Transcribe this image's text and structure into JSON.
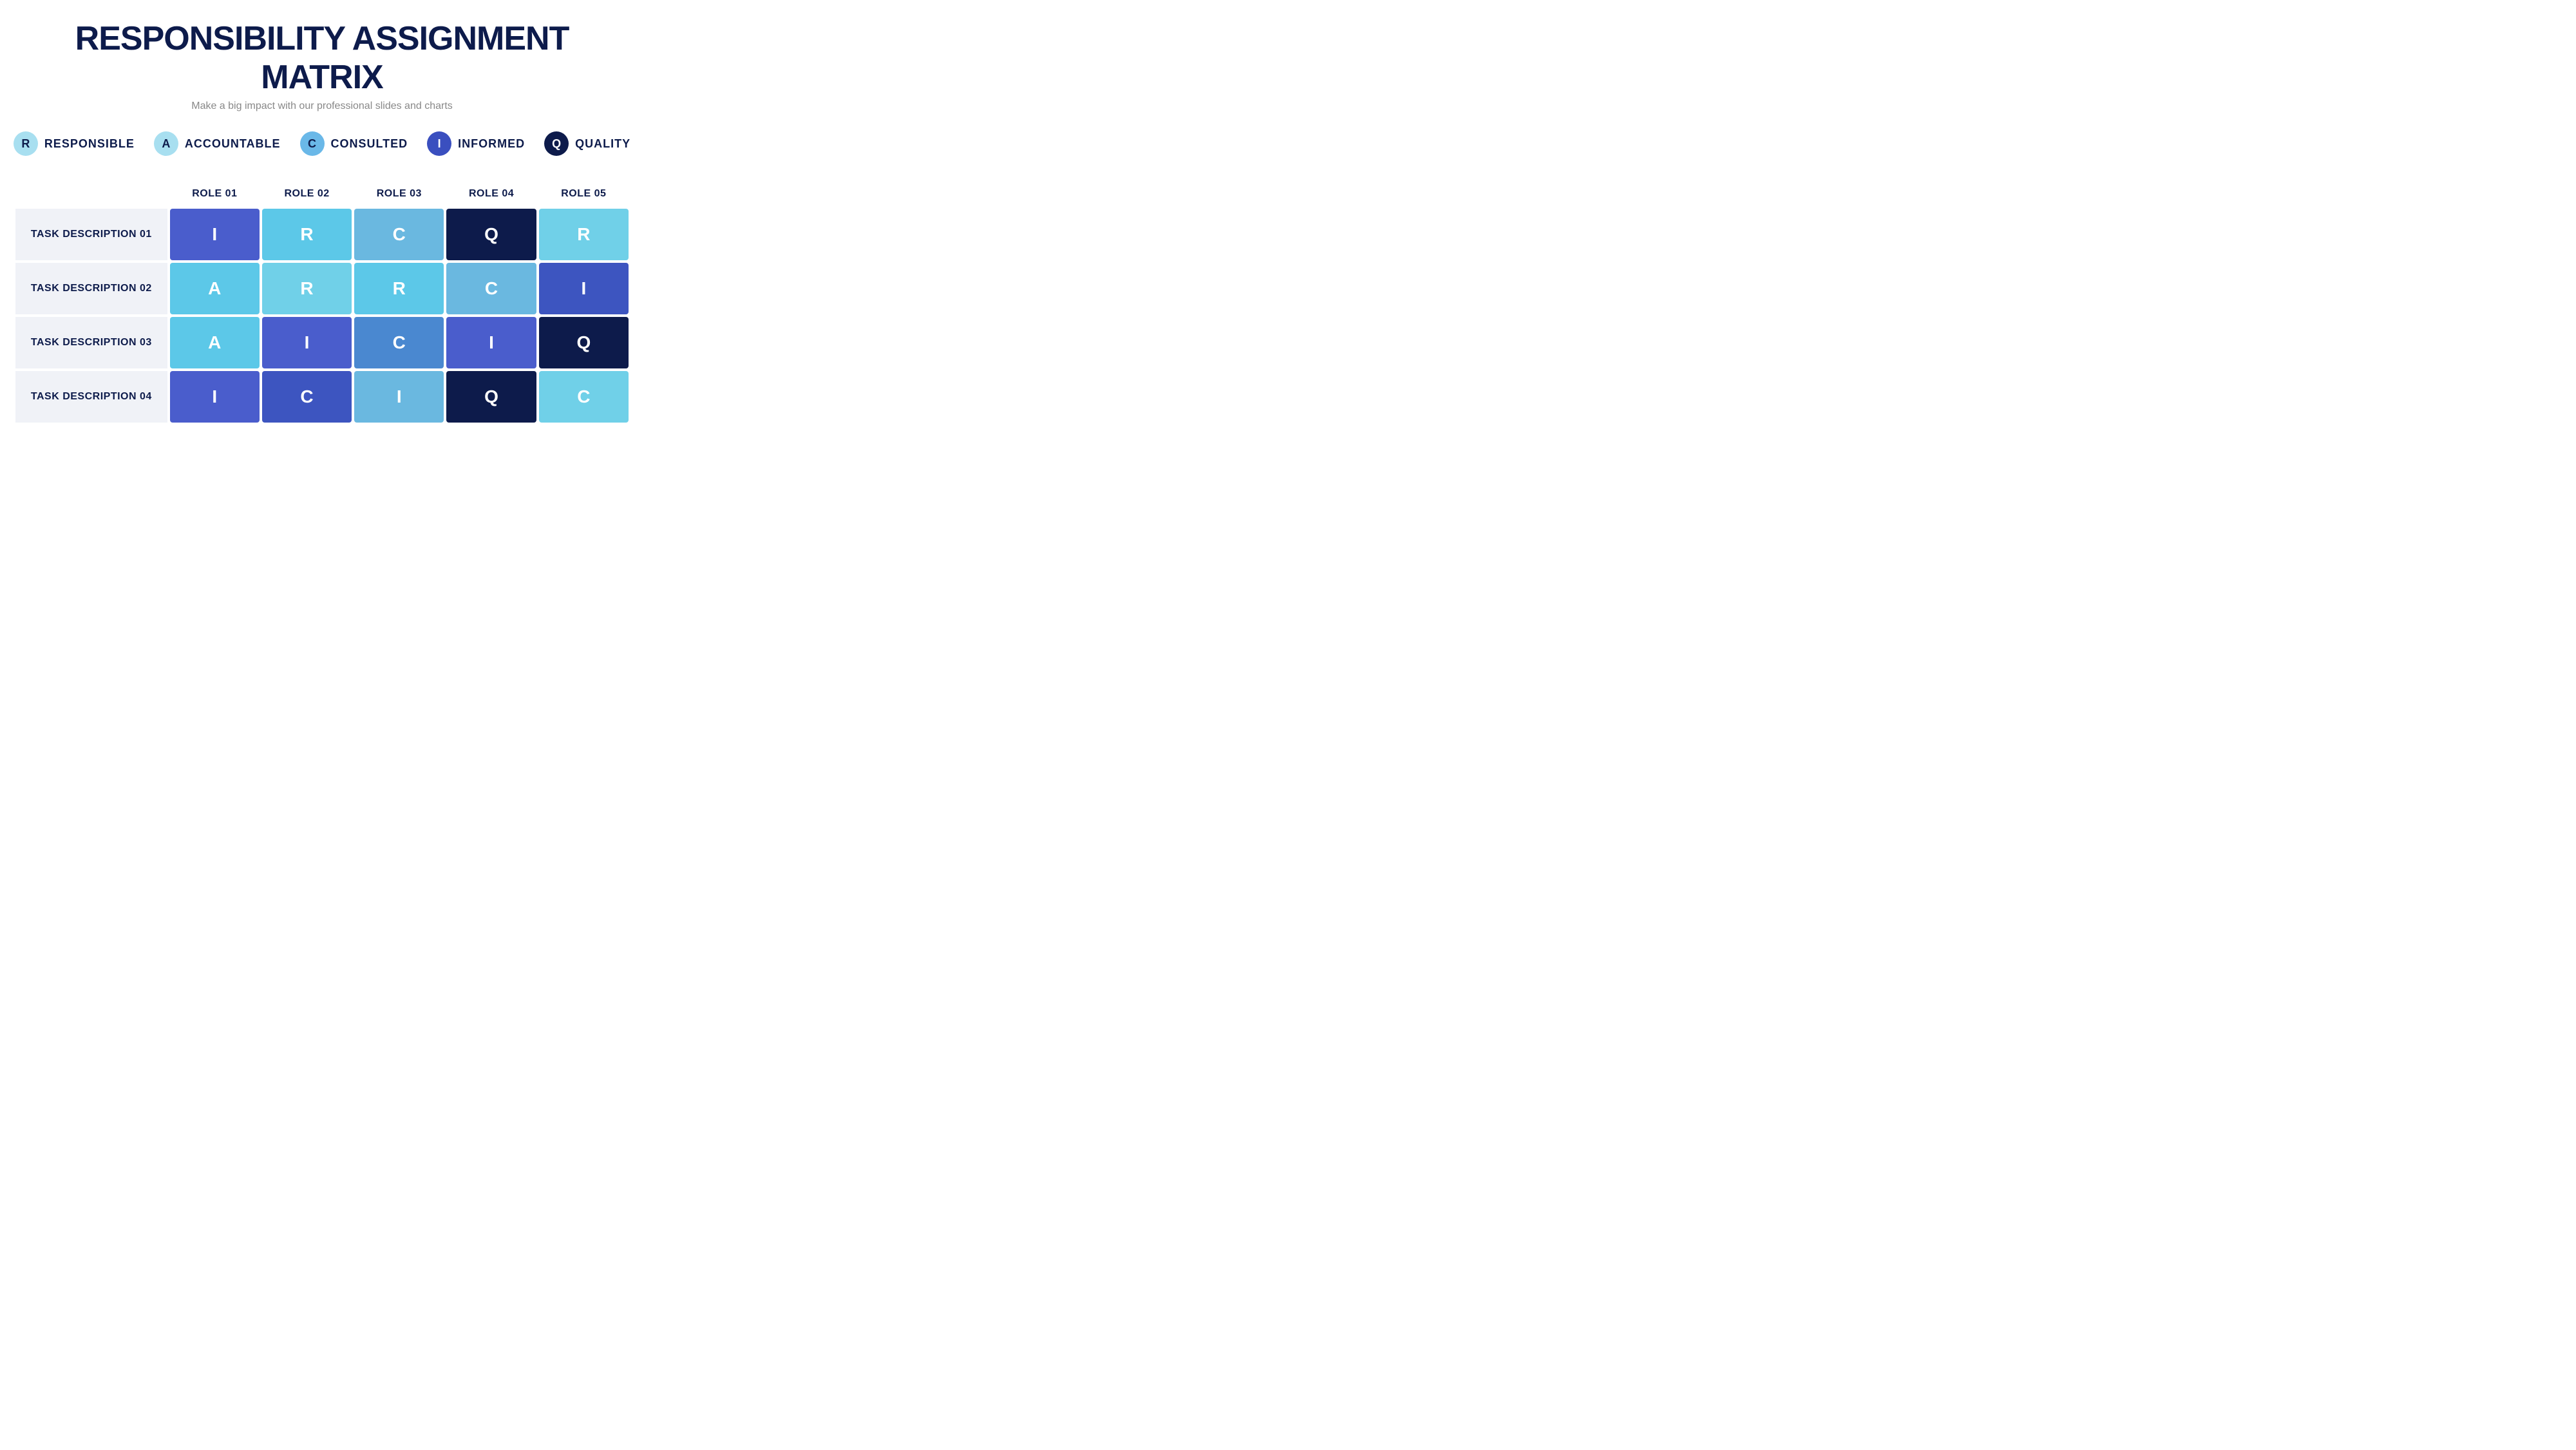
{
  "title": "RESPONSIBILITY ASSIGNMENT MATRIX",
  "subtitle": "Make a big impact with our professional slides and charts",
  "legend": [
    {
      "id": "R",
      "label": "RESPONSIBLE",
      "bg": "#a8dff0",
      "color": "#0d1b4b"
    },
    {
      "id": "A",
      "label": "ACCOUNTABLE",
      "bg": "#a8dff0",
      "color": "#0d1b4b"
    },
    {
      "id": "C",
      "label": "CONSULTED",
      "bg": "#6ab8e8",
      "color": "#0d1b4b"
    },
    {
      "id": "I",
      "label": "INFORMED",
      "bg": "#3a4fbf",
      "color": "#ffffff"
    },
    {
      "id": "Q",
      "label": "QUALITY",
      "bg": "#0d1b4b",
      "color": "#ffffff"
    }
  ],
  "columns": [
    "ROLE 01",
    "ROLE 02",
    "ROLE 03",
    "ROLE 04",
    "ROLE 05"
  ],
  "rows": [
    {
      "task": "TASK DESCRIPTION 01",
      "cells": [
        {
          "letter": "I",
          "style": "cell-blue-mid"
        },
        {
          "letter": "R",
          "style": "cell-cyan-light"
        },
        {
          "letter": "C",
          "style": "cell-blue-light"
        },
        {
          "letter": "Q",
          "style": "cell-dark-navy"
        },
        {
          "letter": "R",
          "style": "cell-cyan-mid"
        }
      ]
    },
    {
      "task": "TASK DESCRIPTION 02",
      "cells": [
        {
          "letter": "A",
          "style": "cell-cyan-light"
        },
        {
          "letter": "R",
          "style": "cell-cyan-mid"
        },
        {
          "letter": "R",
          "style": "cell-cyan-light"
        },
        {
          "letter": "C",
          "style": "cell-blue-light"
        },
        {
          "letter": "I",
          "style": "cell-indigo"
        }
      ]
    },
    {
      "task": "TASK DESCRIPTION 03",
      "cells": [
        {
          "letter": "A",
          "style": "cell-cyan-light"
        },
        {
          "letter": "I",
          "style": "cell-blue-mid"
        },
        {
          "letter": "C",
          "style": "cell-blue-medium"
        },
        {
          "letter": "I",
          "style": "cell-blue-mid"
        },
        {
          "letter": "Q",
          "style": "cell-dark-navy"
        }
      ]
    },
    {
      "task": "TASK DESCRIPTION 04",
      "cells": [
        {
          "letter": "I",
          "style": "cell-blue-mid"
        },
        {
          "letter": "C",
          "style": "cell-indigo"
        },
        {
          "letter": "I",
          "style": "cell-blue-light"
        },
        {
          "letter": "Q",
          "style": "cell-dark-navy"
        },
        {
          "letter": "C",
          "style": "cell-cyan-mid"
        }
      ]
    }
  ]
}
